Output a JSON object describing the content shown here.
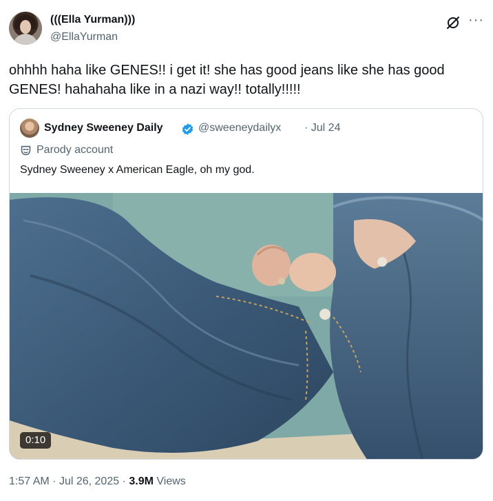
{
  "author": {
    "display_name": "(((Ella Yurman)))",
    "handle": "@EllaYurman",
    "avatar_icon": "profile-photo"
  },
  "tweet": {
    "text": "ohhhh haha like GENES!! i get it! she has good jeans like she has good GENES! hahahaha like in a nazi way!! totally!!!!!"
  },
  "actions": {
    "grok_icon": "grok-slash-circle-icon",
    "more_icon": "ellipsis-icon",
    "more_label": "···"
  },
  "quote": {
    "display_name": "Sydney Sweeney Daily",
    "handle": "@sweeneydailyx",
    "date": "· Jul 24",
    "badge_label": "Parody account",
    "text": "Sydney Sweeney x American Eagle, oh my god.",
    "video_duration": "0:10",
    "verified_color": "#1d9bf0"
  },
  "meta": {
    "time": "1:57 AM",
    "date": "Jul 26, 2025",
    "views_count": "3.9M",
    "views_label": "Views"
  }
}
